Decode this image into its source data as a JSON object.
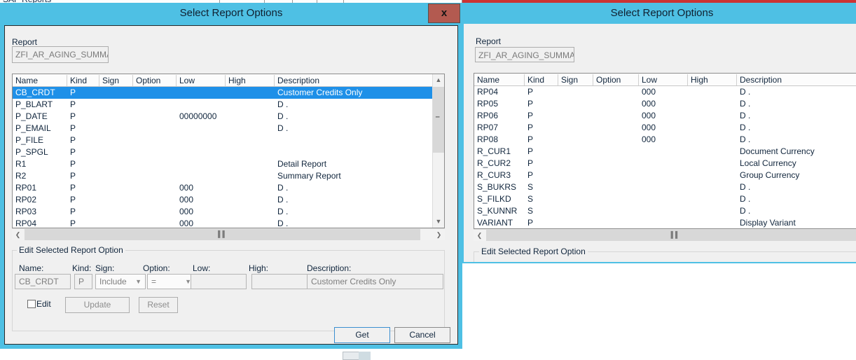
{
  "background": {
    "partial_window_title": "SAP Reports"
  },
  "columns": [
    "Name",
    "Kind",
    "Sign",
    "Option",
    "Low",
    "High",
    "Description"
  ],
  "left_dialog": {
    "title": "Select Report Options",
    "close_label": "x",
    "report_group_label": "Report",
    "report_value": "ZFI_AR_AGING_SUMMARY",
    "rows": [
      {
        "name": "CB_CRDT",
        "kind": "P",
        "sign": "",
        "option": "",
        "low": "",
        "high": "",
        "description": "Customer Credits Only",
        "selected": true
      },
      {
        "name": "P_BLART",
        "kind": "P",
        "sign": "",
        "option": "",
        "low": "",
        "high": "",
        "description": "D     .",
        "selected": false
      },
      {
        "name": "P_DATE",
        "kind": "P",
        "sign": "",
        "option": "",
        "low": "00000000",
        "high": "",
        "description": "D     .",
        "selected": false
      },
      {
        "name": "P_EMAIL",
        "kind": "P",
        "sign": "",
        "option": "",
        "low": "",
        "high": "",
        "description": "D     .",
        "selected": false
      },
      {
        "name": "P_FILE",
        "kind": "P",
        "sign": "",
        "option": "",
        "low": "",
        "high": "",
        "description": "",
        "selected": false
      },
      {
        "name": "P_SPGL",
        "kind": "P",
        "sign": "",
        "option": "",
        "low": "",
        "high": "",
        "description": "",
        "selected": false
      },
      {
        "name": "R1",
        "kind": "P",
        "sign": "",
        "option": "",
        "low": "",
        "high": "",
        "description": "Detail Report",
        "selected": false
      },
      {
        "name": "R2",
        "kind": "P",
        "sign": "",
        "option": "",
        "low": "",
        "high": "",
        "description": "Summary Report",
        "selected": false
      },
      {
        "name": "RP01",
        "kind": "P",
        "sign": "",
        "option": "",
        "low": "000",
        "high": "",
        "description": "D     .",
        "selected": false
      },
      {
        "name": "RP02",
        "kind": "P",
        "sign": "",
        "option": "",
        "low": "000",
        "high": "",
        "description": "D     .",
        "selected": false
      },
      {
        "name": "RP03",
        "kind": "P",
        "sign": "",
        "option": "",
        "low": "000",
        "high": "",
        "description": "D     .",
        "selected": false
      },
      {
        "name": "RP04",
        "kind": "P",
        "sign": "",
        "option": "",
        "low": "000",
        "high": "",
        "description": "D     .",
        "selected": false
      }
    ],
    "edit_panel": {
      "group_label": "Edit Selected Report Option",
      "labels": {
        "name": "Name:",
        "kind": "Kind:",
        "sign": "Sign:",
        "option": "Option:",
        "low": "Low:",
        "high": "High:",
        "description": "Description:"
      },
      "values": {
        "name": "CB_CRDT",
        "kind": "P",
        "sign": "Include",
        "option": "=",
        "low": "",
        "high": "",
        "description": "Customer Credits Only"
      },
      "edit_checkbox_label": "Edit",
      "edit_checked": false,
      "update_label": "Update",
      "reset_label": "Reset"
    },
    "get_label": "Get",
    "cancel_label": "Cancel"
  },
  "right_dialog": {
    "title": "Select Report Options",
    "report_group_label": "Report",
    "report_value": "ZFI_AR_AGING_SUMMARY",
    "rows": [
      {
        "name": "RP04",
        "kind": "P",
        "sign": "",
        "option": "",
        "low": "000",
        "high": "",
        "description": "D     ."
      },
      {
        "name": "RP05",
        "kind": "P",
        "sign": "",
        "option": "",
        "low": "000",
        "high": "",
        "description": "D     ."
      },
      {
        "name": "RP06",
        "kind": "P",
        "sign": "",
        "option": "",
        "low": "000",
        "high": "",
        "description": "D     ."
      },
      {
        "name": "RP07",
        "kind": "P",
        "sign": "",
        "option": "",
        "low": "000",
        "high": "",
        "description": "D     ."
      },
      {
        "name": "RP08",
        "kind": "P",
        "sign": "",
        "option": "",
        "low": "000",
        "high": "",
        "description": "D     ."
      },
      {
        "name": "R_CUR1",
        "kind": "P",
        "sign": "",
        "option": "",
        "low": "",
        "high": "",
        "description": "Document Currency"
      },
      {
        "name": "R_CUR2",
        "kind": "P",
        "sign": "",
        "option": "",
        "low": "",
        "high": "",
        "description": "Local Currency"
      },
      {
        "name": "R_CUR3",
        "kind": "P",
        "sign": "",
        "option": "",
        "low": "",
        "high": "",
        "description": "Group Currency"
      },
      {
        "name": "S_BUKRS",
        "kind": "S",
        "sign": "",
        "option": "",
        "low": "",
        "high": "",
        "description": "D     ."
      },
      {
        "name": "S_FILKD",
        "kind": "S",
        "sign": "",
        "option": "",
        "low": "",
        "high": "",
        "description": "D     ."
      },
      {
        "name": "S_KUNNR",
        "kind": "S",
        "sign": "",
        "option": "",
        "low": "",
        "high": "",
        "description": "D     ."
      },
      {
        "name": "VARIANT",
        "kind": "P",
        "sign": "",
        "option": "",
        "low": "",
        "high": "",
        "description": "Display Variant"
      }
    ],
    "edit_panel_label": "Edit Selected Report Option"
  },
  "colors": {
    "title_bar": "#4ec0e4",
    "close_button": "#b35a50",
    "selection": "#1e90e8",
    "dialog_face": "#f0f0f0",
    "accent_border": "#cc3333"
  }
}
